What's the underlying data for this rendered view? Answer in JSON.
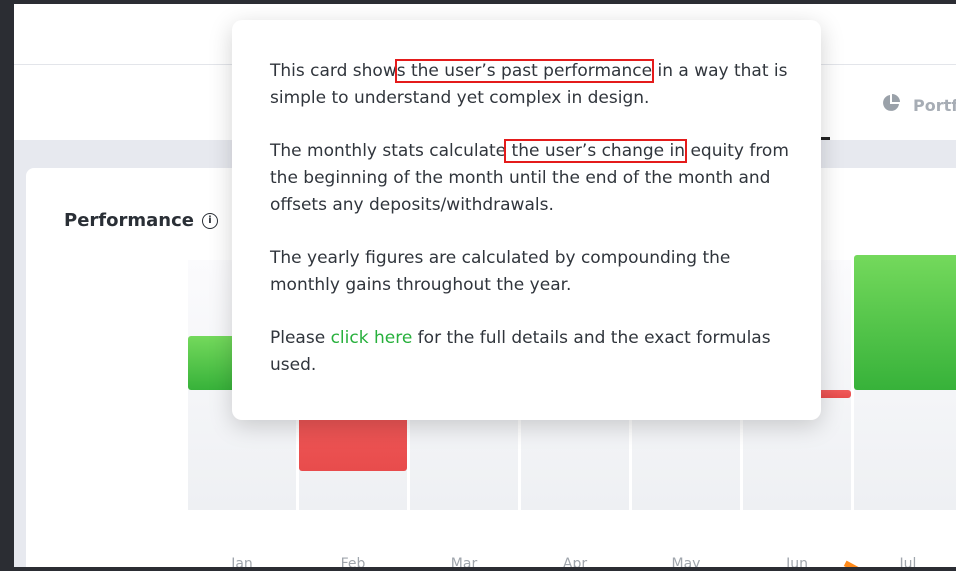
{
  "header": {
    "portfolio_tab_label": "Portf"
  },
  "performance_card": {
    "title": "Performance"
  },
  "chart_data": {
    "type": "bar",
    "categories": [
      "Jan",
      "Feb",
      "Mar",
      "Apr",
      "May",
      "Jun",
      "Jul"
    ],
    "values": [
      1.0,
      -1.5,
      null,
      null,
      null,
      -0.15,
      2.5
    ],
    "colors": {
      "positive": "#4cc447",
      "negative": "#ea4f4f"
    }
  },
  "tooltip": {
    "p1_before": "This card show",
    "p1_highlight": "s the user’s past performance",
    "p1_after": " in a way that is simple to understand yet complex in design.",
    "p2_before": "The monthly stats calculate",
    "p2_highlight": " the user’s change in",
    "p2_after": " equity from the beginning of the month until the end of the month and offsets any deposits/withdrawals.",
    "p3": "The yearly figures are calculated by compounding the monthly gains throughout the year.",
    "p4_before": "Please ",
    "p4_link": "click here",
    "p4_after": " for the full details and the exact formulas used."
  }
}
